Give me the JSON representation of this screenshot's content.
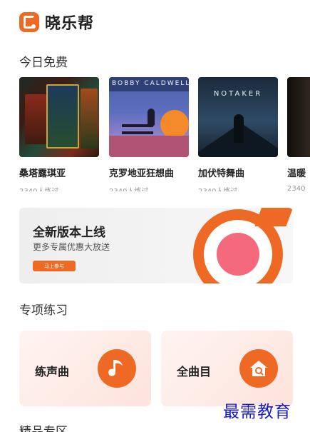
{
  "app": {
    "title": "晓乐帮",
    "accent": "#ee6a24"
  },
  "sections": {
    "free_today": "今日免费",
    "practice": "专项练习",
    "featured": "精品专区"
  },
  "songs": [
    {
      "name": "桑塔露琪亚",
      "meta": "2340人练过"
    },
    {
      "name": "克罗地亚狂想曲",
      "meta": "2340人练过",
      "cover_text": "BOBBY CALDWELL"
    },
    {
      "name": "加伏特舞曲",
      "meta": "2340人练过",
      "cover_text": "NOTAKER"
    },
    {
      "name": "温暖",
      "meta": "2340"
    }
  ],
  "banner": {
    "title": "全新版本上线",
    "subtitle": "更多专属优惠大放送",
    "button": "马上参与"
  },
  "practice_cards": [
    {
      "label": "练声曲",
      "icon": "music-note-icon"
    },
    {
      "label": "全曲目",
      "icon": "home-icon"
    }
  ],
  "watermark": "最需教育"
}
